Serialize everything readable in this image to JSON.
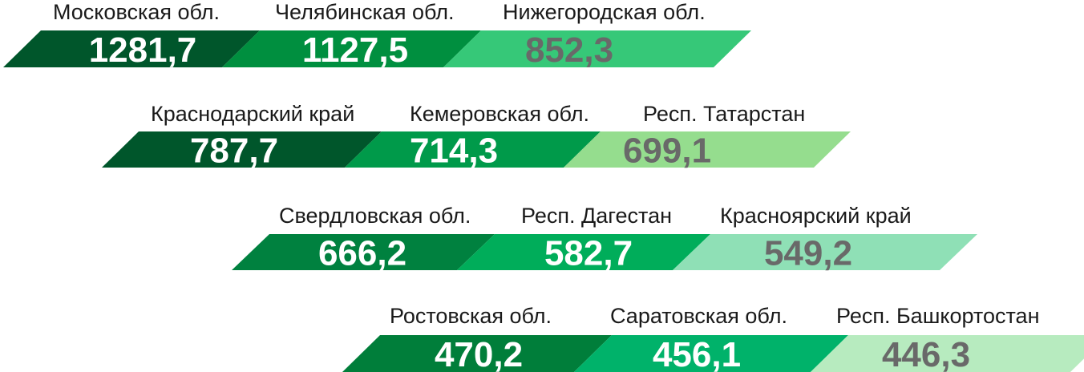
{
  "chart_data": {
    "type": "bar",
    "title": "",
    "unit": "",
    "rows": [
      {
        "items": [
          {
            "name": "Московская обл.",
            "value": "1281,7",
            "color": "#00562b",
            "text_color": "#ffffff"
          },
          {
            "name": "Челябинская обл.",
            "value": "1127,5",
            "color": "#008f3f",
            "text_color": "#ffffff"
          },
          {
            "name": "Нижегородская обл.",
            "value": "852,3",
            "color": "#36c878",
            "text_color": "#696969"
          }
        ]
      },
      {
        "items": [
          {
            "name": "Краснодарский край",
            "value": "787,7",
            "color": "#00562b",
            "text_color": "#ffffff"
          },
          {
            "name": "Кемеровская обл.",
            "value": "714,3",
            "color": "#009a4a",
            "text_color": "#ffffff"
          },
          {
            "name": "Респ. Татарстан",
            "value": "699,1",
            "color": "#95dd8e",
            "text_color": "#696969"
          }
        ]
      },
      {
        "items": [
          {
            "name": "Свердловская обл.",
            "value": "666,2",
            "color": "#00813f",
            "text_color": "#ffffff"
          },
          {
            "name": "Респ. Дагестан",
            "value": "582,7",
            "color": "#00ad5a",
            "text_color": "#ffffff"
          },
          {
            "name": "Красноярский край",
            "value": "549,2",
            "color": "#8fe0b6",
            "text_color": "#696969"
          }
        ]
      },
      {
        "items": [
          {
            "name": "Ростовская обл.",
            "value": "470,2",
            "color": "#007e3a",
            "text_color": "#ffffff"
          },
          {
            "name": "Саратовская обл.",
            "value": "456,1",
            "color": "#00b26a",
            "text_color": "#ffffff"
          },
          {
            "name": "Респ. Башкортостан",
            "value": "446,3",
            "color": "#b7ebbf",
            "text_color": "#696969"
          }
        ]
      }
    ]
  }
}
